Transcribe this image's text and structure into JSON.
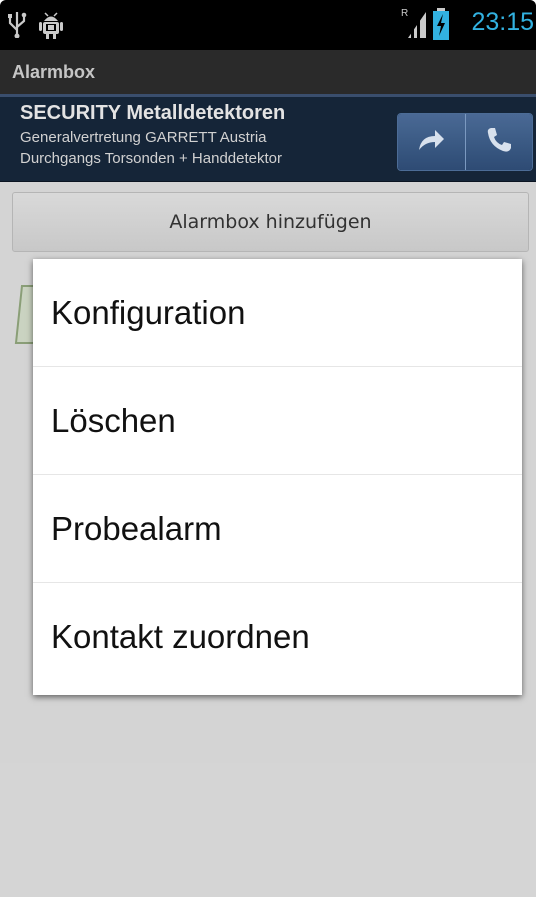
{
  "status_bar": {
    "time": "23:15",
    "left_icons": [
      "usb-icon",
      "android-debug-icon"
    ],
    "right_icons": [
      "roaming-signal-icon",
      "battery-charging-icon"
    ],
    "roaming_letter": "R",
    "clock_color": "#33b5e5"
  },
  "action_bar": {
    "title": "Alarmbox"
  },
  "banner": {
    "title": "SECURITY Metalldetektoren",
    "line1": "Generalvertretung GARRETT Austria",
    "line2": "Durchgangs Torsonden + Handdetektor",
    "buttons": [
      {
        "icon": "share-arrow-icon"
      },
      {
        "icon": "phone-icon"
      }
    ]
  },
  "main": {
    "add_button_label": "Alarmbox hinzufügen"
  },
  "context_menu": {
    "items": [
      {
        "label": "Konfiguration"
      },
      {
        "label": "Löschen"
      },
      {
        "label": "Probealarm"
      },
      {
        "label": "Kontakt zuordnen"
      }
    ]
  }
}
